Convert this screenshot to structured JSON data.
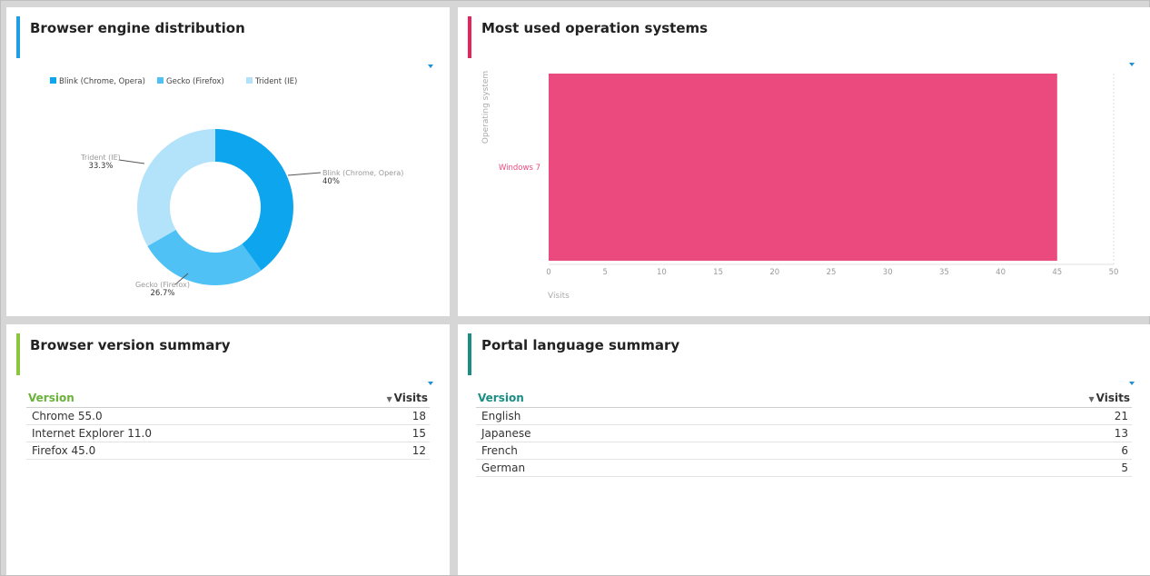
{
  "colors": {
    "accent_engine": "#1e9fe3",
    "accent_os": "#e5245b",
    "accent_version": "#8cc63f",
    "accent_language": "#1a8e84",
    "version_header": "#6ab23b",
    "language_header": "#1a8e84"
  },
  "widgets": {
    "engine": {
      "title": "Browser engine distribution"
    },
    "os": {
      "title": "Most used operation systems"
    },
    "version": {
      "title": "Browser version summary",
      "columns": {
        "version": "Version",
        "visits": "Visits"
      },
      "rows": [
        {
          "version": "Chrome 55.0",
          "visits": "18"
        },
        {
          "version": "Internet Explorer 11.0",
          "visits": "15"
        },
        {
          "version": "Firefox 45.0",
          "visits": "12"
        }
      ]
    },
    "language": {
      "title": "Portal language summary",
      "columns": {
        "version": "Version",
        "visits": "Visits"
      },
      "rows": [
        {
          "version": "English",
          "visits": "21"
        },
        {
          "version": "Japanese",
          "visits": "13"
        },
        {
          "version": "French",
          "visits": "6"
        },
        {
          "version": "German",
          "visits": "5"
        }
      ]
    }
  },
  "chart_data": [
    {
      "type": "pie",
      "title": "Browser engine distribution",
      "legend": "top",
      "slices": [
        {
          "label": "Blink (Chrome, Opera)",
          "value": 40,
          "pct_label": "40%",
          "color": "#0ea5ef"
        },
        {
          "label": "Gecko (Firefox)",
          "value": 26.7,
          "pct_label": "26.7%",
          "color": "#4fc1f5"
        },
        {
          "label": "Trident (IE)",
          "value": 33.3,
          "pct_label": "33.3%",
          "color": "#b3e3fa"
        }
      ]
    },
    {
      "type": "bar",
      "title": "Most used operation systems",
      "orientation": "horizontal",
      "categories": [
        "Windows 7"
      ],
      "values": [
        45
      ],
      "color": "#ea4a7d",
      "xlabel": "Visits",
      "ylabel": "Operating system",
      "xlim": [
        0,
        50
      ],
      "xticks": [
        0,
        5,
        10,
        15,
        20,
        25,
        30,
        35,
        40,
        45,
        50
      ]
    }
  ]
}
